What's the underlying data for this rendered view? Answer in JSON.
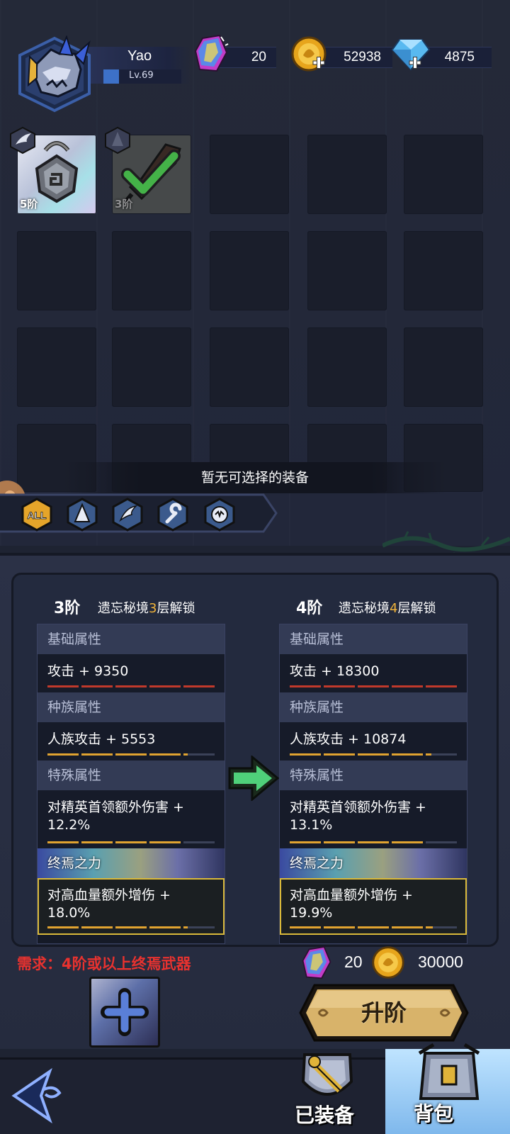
{
  "player": {
    "name": "Yao",
    "level": "Lv.69"
  },
  "resources": {
    "crystal": "20",
    "gold": "52938",
    "diamond": "4875"
  },
  "inventory": {
    "items": [
      {
        "tier_label": "5阶",
        "icon": "amulet-icon",
        "rarity": "silver"
      },
      {
        "tier_label": "3阶",
        "icon": "sword-checked-icon",
        "rarity": "gray"
      }
    ],
    "empty_message": "暂无可选择的装备"
  },
  "filters": [
    "ALL",
    "armor-icon",
    "wing-icon",
    "wrench-icon",
    "beast-icon"
  ],
  "compare": {
    "left": {
      "tier": "3阶",
      "unlock_prefix": "遗忘秘境",
      "unlock_num": "3",
      "unlock_suffix": "层解锁",
      "base_head": "基础属性",
      "base_stat": "攻击 + 9350",
      "race_head": "种族属性",
      "race_stat": "人族攻击 + 5553",
      "special_head": "特殊属性",
      "special_stat_1": "对精英首领额外伤害 +",
      "special_stat_2": "12.2%",
      "legend_head": "终焉之力",
      "legend_stat_1": "对高血量额外增伤 +",
      "legend_stat_2": "18.0%"
    },
    "right": {
      "tier": "4阶",
      "unlock_prefix": "遗忘秘境",
      "unlock_num": "4",
      "unlock_suffix": "层解锁",
      "base_head": "基础属性",
      "base_stat": "攻击 + 18300",
      "race_head": "种族属性",
      "race_stat": "人族攻击 + 10874",
      "special_head": "特殊属性",
      "special_stat_1": "对精英首领额外伤害 +",
      "special_stat_2": "13.1%",
      "legend_head": "终焉之力",
      "legend_stat_1": "对高血量额外增伤 +",
      "legend_stat_2": "19.9%"
    }
  },
  "requirement": "需求：4阶或以上终焉武器",
  "cost": {
    "crystal": "20",
    "gold": "30000"
  },
  "upgrade_label": "升阶",
  "nav": {
    "equipped": "已装备",
    "bag": "背包"
  },
  "colors": {
    "background": "#1e2332",
    "accent_gold": "#f0b33a",
    "requirement_red": "#e8322f",
    "legend_border": "#d9b93a"
  }
}
